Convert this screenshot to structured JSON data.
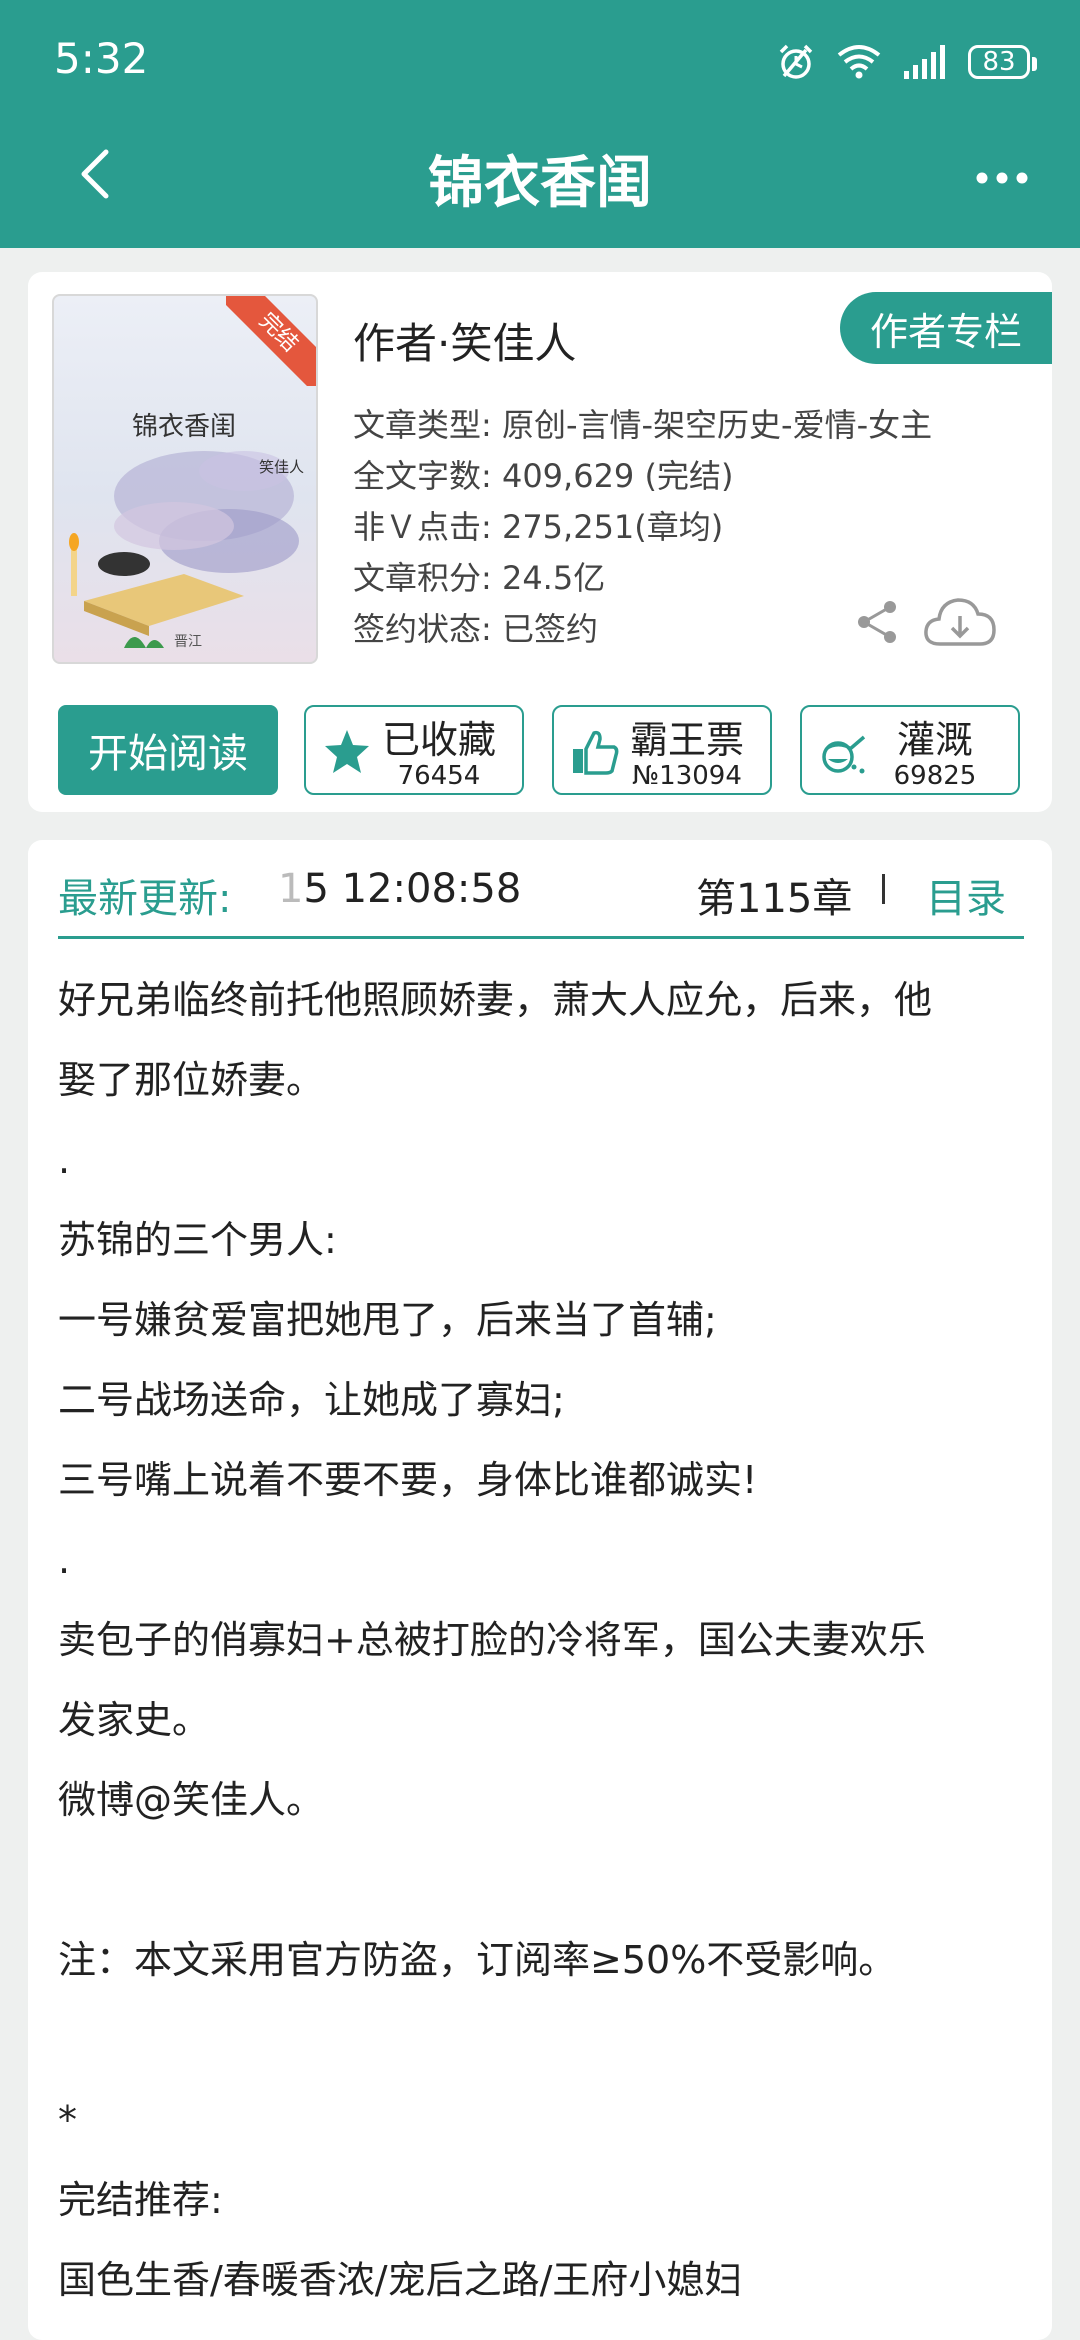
{
  "status_bar": {
    "time": "5:32",
    "battery": "83"
  },
  "nav": {
    "title": "锦衣香闺"
  },
  "cover": {
    "title": "锦衣香闺",
    "author": "笑佳人",
    "badge": "完结"
  },
  "book": {
    "author_line": "作者·笑佳人",
    "author_column_label": "作者专栏",
    "info": [
      "文章类型: 原创-言情-架空历史-爱情-女主",
      "全文字数: 409,629 (完结)",
      "非Ｖ点击: 275,251(章均)",
      "文章积分: 24.5亿",
      "签约状态: 已签约"
    ]
  },
  "actions": {
    "read_label": "开始阅读",
    "favorite": {
      "label": "已收藏",
      "count": "76454"
    },
    "vote": {
      "label": "霸王票",
      "count": "№13094"
    },
    "water": {
      "label": "灌溉",
      "count": "69825"
    }
  },
  "update": {
    "label": "最新更新:",
    "time_cut": "1",
    "time": "5 12:08:58",
    "chapter": "第115章",
    "toc_label": "目录"
  },
  "description": [
    "好兄弟临终前托他照顾娇妻，萧大人应允，后来，他",
    "娶了那位娇妻。",
    ".",
    "苏锦的三个男人:",
    "一号嫌贫爱富把她甩了，后来当了首辅;",
    "二号战场送命，让她成了寡妇;",
    "三号嘴上说着不要不要，身体比谁都诚实!",
    ".",
    "卖包子的俏寡妇+总被打脸的冷将军，国公夫妻欢乐",
    "发家史。",
    "微博@笑佳人。",
    "",
    "注：本文采用官方防盗，订阅率≥50%不受影响。",
    "",
    "*",
    "完结推荐:",
    "国色生香/春暖香浓/宠后之路/王府小媳妇"
  ],
  "colors": {
    "theme": "#2a9d8f",
    "ribbon": "#e4573d"
  },
  "icons": [
    "alarm-icon",
    "wifi-icon",
    "signal-icon",
    "battery-icon",
    "back-icon",
    "more-icon",
    "share-icon",
    "download-icon",
    "star-icon",
    "thumbs-up-icon",
    "watering-can-icon"
  ]
}
